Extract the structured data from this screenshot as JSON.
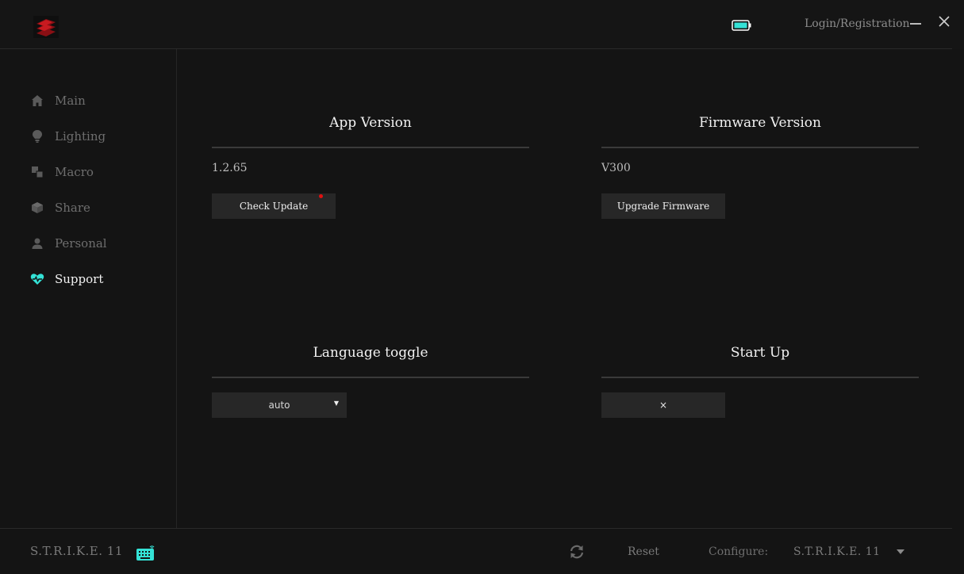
{
  "header": {
    "logo": "mad-catz-logo",
    "battery_color": "#34e2d6",
    "login_label": "Login/Registration"
  },
  "sidebar": {
    "items": [
      {
        "label": "Main",
        "icon": "home-icon",
        "active": false
      },
      {
        "label": "Lighting",
        "icon": "bulb-icon",
        "active": false
      },
      {
        "label": "Macro",
        "icon": "macro-icon",
        "active": false
      },
      {
        "label": "Share",
        "icon": "cube-icon",
        "active": false
      },
      {
        "label": "Personal",
        "icon": "person-icon",
        "active": false
      },
      {
        "label": "Support",
        "icon": "heart-pulse-icon",
        "active": true
      }
    ]
  },
  "main": {
    "app_version": {
      "title": "App Version",
      "value": "1.2.65",
      "button": "Check Update",
      "has_update_dot": true
    },
    "firmware_version": {
      "title": "Firmware Version",
      "value": "V300",
      "button": "Upgrade Firmware"
    },
    "language": {
      "title": "Language toggle",
      "selected": "auto"
    },
    "startup": {
      "title": "Start Up",
      "value": "×"
    }
  },
  "footer": {
    "device_name": "S.T.R.I.K.E. 11",
    "reset_label": "Reset",
    "configure_label": "Configure:",
    "configure_value": "S.T.R.I.K.E. 11"
  },
  "colors": {
    "accent": "#34e2d6",
    "update_dot": "#e01010",
    "background": "#141414"
  }
}
